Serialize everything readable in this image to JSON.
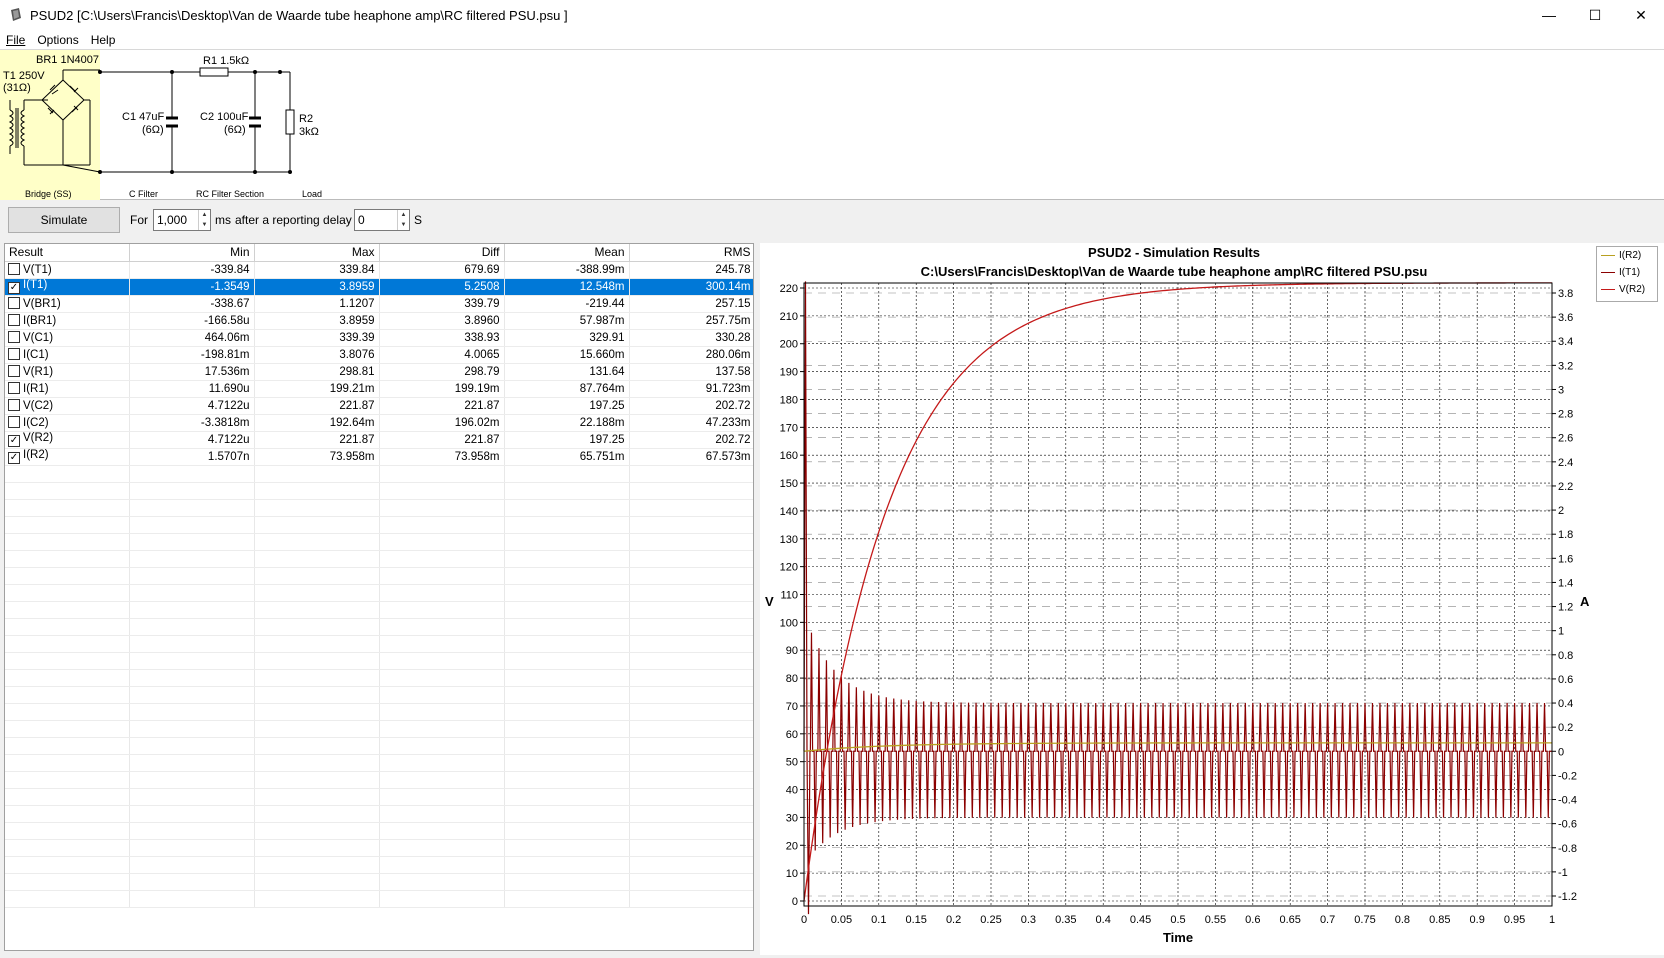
{
  "window": {
    "title": "PSUD2  [C:\\Users\\Francis\\Desktop\\Van de Waarde tube heaphone amp\\RC filtered PSU.psu ]",
    "minimize": "—",
    "maximize": "☐",
    "close": "✕"
  },
  "menu": {
    "file": "File",
    "options": "Options",
    "help": "Help"
  },
  "schematic": {
    "bridge_label": "BR1 1N4007",
    "transformer_label": "T1 250V",
    "transformer_res": "(31Ω)",
    "r1_label": "R1 1.5kΩ",
    "c1_label": "C1 47uF",
    "c1_res": "(6Ω)",
    "c2_label": "C2 100uF",
    "c2_res": "(6Ω)",
    "r2_label": "R2",
    "r2_val": "3kΩ",
    "section_bridge": "Bridge (SS)",
    "section_cfilter": "C Filter",
    "section_rc": "RC Filter Section",
    "section_load": "Load"
  },
  "toolbar": {
    "simulate": "Simulate",
    "for_label": "For",
    "duration": "1,000",
    "ms_label": "ms",
    "delay_label": "after a reporting delay of",
    "delay": "0",
    "s_label": "S"
  },
  "table": {
    "headers": [
      "Result",
      "Min",
      "Max",
      "Diff",
      "Mean",
      "RMS"
    ],
    "rows": [
      {
        "name": "V(T1)",
        "checked": false,
        "selected": false,
        "min": "-339.84",
        "max": "339.84",
        "diff": "679.69",
        "mean": "-388.99m",
        "rms": "245.78"
      },
      {
        "name": "I(T1)",
        "checked": true,
        "selected": true,
        "min": "-1.3549",
        "max": "3.8959",
        "diff": "5.2508",
        "mean": "12.548m",
        "rms": "300.14m"
      },
      {
        "name": "V(BR1)",
        "checked": false,
        "selected": false,
        "min": "-338.67",
        "max": "1.1207",
        "diff": "339.79",
        "mean": "-219.44",
        "rms": "257.15"
      },
      {
        "name": "I(BR1)",
        "checked": false,
        "selected": false,
        "min": "-166.58u",
        "max": "3.8959",
        "diff": "3.8960",
        "mean": "57.987m",
        "rms": "257.75m"
      },
      {
        "name": "V(C1)",
        "checked": false,
        "selected": false,
        "min": "464.06m",
        "max": "339.39",
        "diff": "338.93",
        "mean": "329.91",
        "rms": "330.28"
      },
      {
        "name": "I(C1)",
        "checked": false,
        "selected": false,
        "min": "-198.81m",
        "max": "3.8076",
        "diff": "4.0065",
        "mean": "15.660m",
        "rms": "280.06m"
      },
      {
        "name": "V(R1)",
        "checked": false,
        "selected": false,
        "min": "17.536m",
        "max": "298.81",
        "diff": "298.79",
        "mean": "131.64",
        "rms": "137.58"
      },
      {
        "name": "I(R1)",
        "checked": false,
        "selected": false,
        "min": "11.690u",
        "max": "199.21m",
        "diff": "199.19m",
        "mean": "87.764m",
        "rms": "91.723m"
      },
      {
        "name": "V(C2)",
        "checked": false,
        "selected": false,
        "min": "4.7122u",
        "max": "221.87",
        "diff": "221.87",
        "mean": "197.25",
        "rms": "202.72"
      },
      {
        "name": "I(C2)",
        "checked": false,
        "selected": false,
        "min": "-3.3818m",
        "max": "192.64m",
        "diff": "196.02m",
        "mean": "22.188m",
        "rms": "47.233m"
      },
      {
        "name": "V(R2)",
        "checked": true,
        "selected": false,
        "min": "4.7122u",
        "max": "221.87",
        "diff": "221.87",
        "mean": "197.25",
        "rms": "202.72"
      },
      {
        "name": "I(R2)",
        "checked": true,
        "selected": false,
        "min": "1.5707n",
        "max": "73.958m",
        "diff": "73.958m",
        "mean": "65.751m",
        "rms": "67.573m"
      }
    ]
  },
  "colors": {
    "vr2": "#c41a1a",
    "it1": "#8b0000",
    "ir2": "#b8a020",
    "selection": "#0078d7",
    "schematic_bg": "#ffffc8"
  },
  "chart_data": {
    "type": "line",
    "title": "PSUD2 - Simulation Results",
    "subtitle": "C:\\Users\\Francis\\Desktop\\Van de Waarde tube heaphone amp\\RC filtered PSU.psu",
    "xlabel": "Time",
    "ylabel_left": "V",
    "ylabel_right": "A",
    "xlim": [
      0,
      1
    ],
    "ylim_left": [
      0,
      220
    ],
    "ylim_right": [
      -1.2,
      3.8
    ],
    "x_ticks": [
      "0",
      "0.05",
      "0.1",
      "0.15",
      "0.2",
      "0.25",
      "0.3",
      "0.35",
      "0.4",
      "0.45",
      "0.5",
      "0.55",
      "0.6",
      "0.65",
      "0.7",
      "0.75",
      "0.8",
      "0.85",
      "0.9",
      "0.95",
      "1"
    ],
    "y_left_ticks": [
      "0",
      "10",
      "20",
      "30",
      "40",
      "50",
      "60",
      "70",
      "80",
      "90",
      "100",
      "110",
      "120",
      "130",
      "140",
      "150",
      "160",
      "170",
      "180",
      "190",
      "200",
      "210",
      "220"
    ],
    "y_right_ticks": [
      "-1.2",
      "-1",
      "-0.8",
      "-0.6",
      "-0.4",
      "-0.2",
      "0",
      "0.2",
      "0.4",
      "0.6",
      "0.8",
      "1",
      "1.2",
      "1.4",
      "1.6",
      "1.8",
      "2",
      "2.2",
      "2.4",
      "2.6",
      "2.8",
      "3",
      "3.2",
      "3.4",
      "3.6",
      "3.8"
    ],
    "grid": true,
    "legend_position": "top-right",
    "series": [
      {
        "name": "I(R2)",
        "axis": "right",
        "color": "#b8a020",
        "description_values": {
          "steady": 0.07,
          "max": 0.074
        }
      },
      {
        "name": "I(T1)",
        "axis": "right",
        "color": "#8b0000",
        "description_values": {
          "peak_first": 3.8959,
          "peak_steady": 0.4,
          "trough_steady": -0.55,
          "period": 0.01
        }
      },
      {
        "name": "V(R2)",
        "axis": "left",
        "color": "#c41a1a",
        "description_values": {
          "start": 0,
          "final": 221.87,
          "tau": 0.11
        }
      }
    ]
  }
}
